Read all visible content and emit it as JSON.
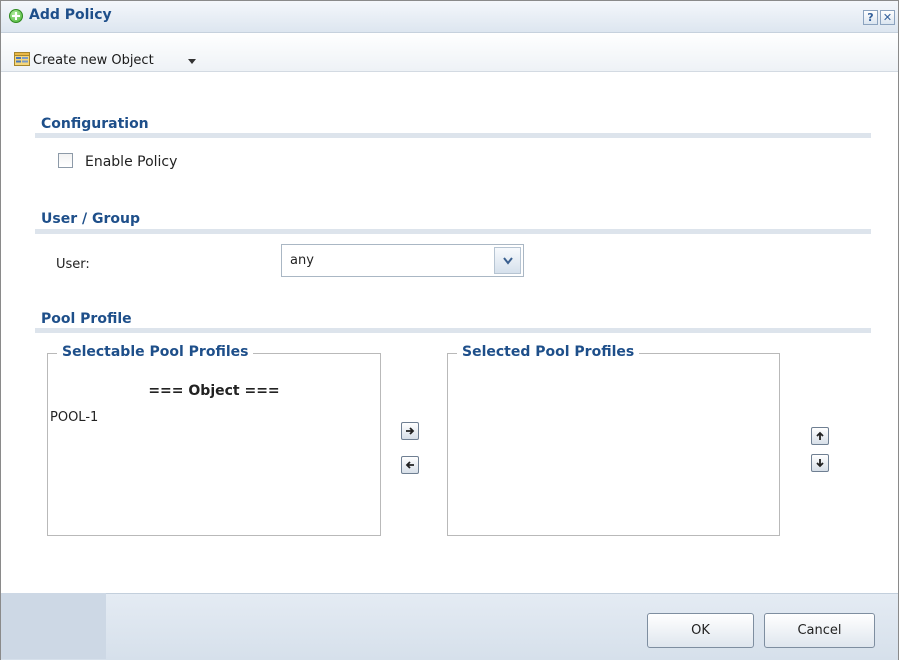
{
  "dialog": {
    "title": "Add Policy",
    "help_label": "?",
    "close_label": "✕"
  },
  "toolbar": {
    "create_label": "Create new Object"
  },
  "configuration": {
    "title": "Configuration",
    "enable_label": "Enable Policy",
    "enable_checked": false
  },
  "user_group": {
    "title": "User / Group",
    "user_label": "User:",
    "user_value": "any"
  },
  "pool_profile": {
    "title": "Pool Profile",
    "selectable": {
      "legend": "Selectable Pool Profiles",
      "header": "=== Object ===",
      "items": [
        "POOL-1"
      ]
    },
    "selected": {
      "legend": "Selected Pool Profiles",
      "items": []
    }
  },
  "buttons": {
    "ok": "OK",
    "cancel": "Cancel"
  },
  "icons": {
    "title": "add-circle-icon",
    "toolbar": "object-icon",
    "dropdown": "chevron-down-icon",
    "move_right": "arrow-right-icon",
    "move_left": "arrow-left-icon",
    "move_up": "arrow-up-icon",
    "move_down": "arrow-down-icon"
  },
  "colors": {
    "heading": "#1e4f8a",
    "accent_green": "#3fae2a"
  }
}
